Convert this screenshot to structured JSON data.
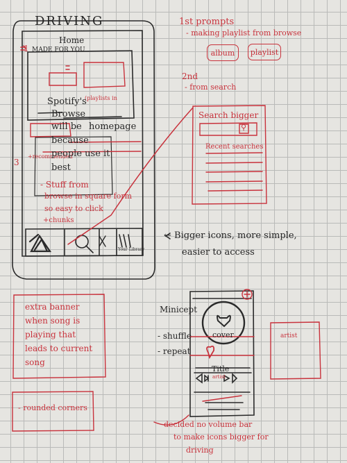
{
  "home_sketch": {
    "title": "DRIVING",
    "home_label": "Home",
    "made_for_you": "MADE FOR YOU",
    "badge_1": "1",
    "badge_3": "3",
    "notes": [
      "Spotify's",
      "Browse",
      "will be",
      "homepage",
      "because",
      "people use it",
      "best"
    ],
    "note_stuff": [
      "- Stuff from",
      "browse in square form",
      "so easy to click"
    ],
    "wchunks": "+chunks",
    "playlist_ann": "(playlists in",
    "recommended_ann": "+recommended",
    "nav_your_library": "Your Library"
  },
  "prompts": {
    "first": "1st prompts",
    "first_sub": "- making playlist from browse",
    "album_btn": "album",
    "playlist_btn": "playlist",
    "second": "2nd",
    "second_sub": "- from search"
  },
  "search_sketch": {
    "title": "Search bigger",
    "recent": "Recent searches"
  },
  "icon_note": [
    "← Bigger icons, more simple,",
    "easier to access"
  ],
  "player_sketch": {
    "cover": "cover",
    "title": "Title",
    "artist": "artist",
    "left_notes": [
      "Minicept",
      "- shuffle",
      "- repeat"
    ],
    "right_box": "artist"
  },
  "banner_note": [
    "extra banner",
    "when song is",
    "playing that",
    "leads to current",
    "song"
  ],
  "rounded_note": "- rounded corners",
  "volume_note": [
    "decided no volume bar",
    "to make icons bigger for",
    "driving"
  ]
}
